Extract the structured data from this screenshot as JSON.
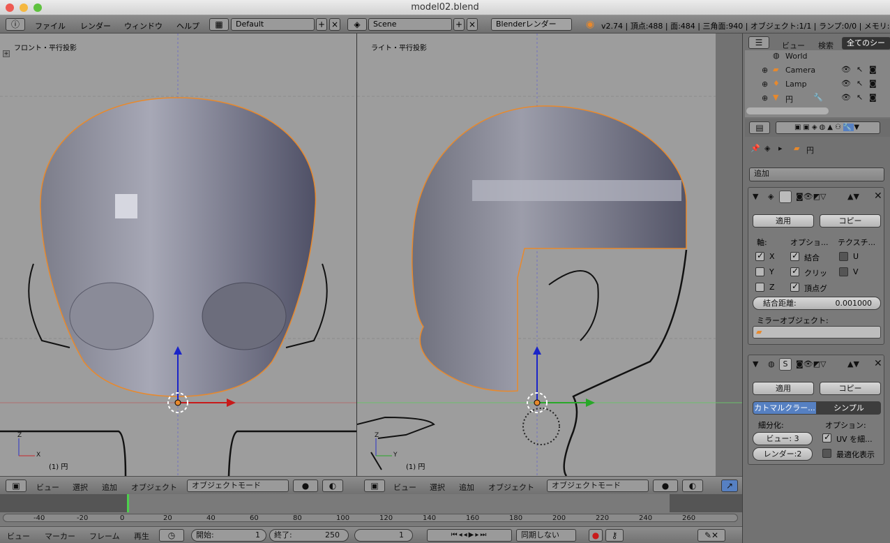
{
  "window": {
    "title": "model02.blend"
  },
  "info": {
    "menus": [
      "ファイル",
      "レンダー",
      "ウィンドウ",
      "ヘルプ"
    ],
    "layout": "Default",
    "scene": "Scene",
    "engine": "Blenderレンダー",
    "stats": "v2.74 | 頂点:488 | 面:484 | 三角面:940 | オブジェクト:1/1 | ランプ:0/0 | メモリ:37"
  },
  "viewport_left": {
    "title": "フロント・平行投影",
    "obj": "(1) 円"
  },
  "viewport_right": {
    "title": "ライト・平行投影",
    "obj": "(1) 円"
  },
  "header3d": {
    "view": "ビュー",
    "select": "選択",
    "add": "追加",
    "object": "オブジェクト",
    "mode": "オブジェクトモード"
  },
  "timeline": {
    "ticks": [
      "-40",
      "-20",
      "0",
      "20",
      "40",
      "60",
      "80",
      "100",
      "120",
      "140",
      "160",
      "180",
      "200",
      "220",
      "240",
      "260"
    ],
    "current_frame": "1"
  },
  "timebar": {
    "view": "ビュー",
    "marker": "マーカー",
    "frame": "フレーム",
    "play": "再生",
    "start": "開始:",
    "start_val": "1",
    "end": "終了:",
    "end_val": "250",
    "frame_val": "1",
    "sync": "同期しない"
  },
  "outliner": {
    "view": "ビュー",
    "search": "検索",
    "scope": "全てのシーン",
    "items": [
      "World",
      "Camera",
      "Lamp",
      "円"
    ]
  },
  "props": {
    "object": "円",
    "add": "追加",
    "mirror": {
      "apply": "適用",
      "copy": "コピー",
      "axis": "軸:",
      "options": "オプショ...",
      "texture": "テクスチ...",
      "x": "X",
      "y": "Y",
      "z": "Z",
      "merge": "結合",
      "clip": "クリッ",
      "vgroup": "頂点グ",
      "u": "U",
      "v": "V",
      "merge_dist": "結合距離:",
      "merge_val": "0.001000",
      "mirror_obj": "ミラーオブジェクト:"
    },
    "subsurf": {
      "label": "S",
      "apply": "適用",
      "copy": "コピー",
      "catmull": "カトマルクラー...",
      "simple": "シンプル",
      "subdiv": "細分化:",
      "options": "オプション:",
      "view": "ビュー:",
      "view_val": "3",
      "render": "レンダー:",
      "render_val": "2",
      "uv": "UV を細...",
      "optimal": "最適化表示"
    }
  },
  "colors": {
    "accent": "#5680c2",
    "selected": "#e8892c"
  }
}
